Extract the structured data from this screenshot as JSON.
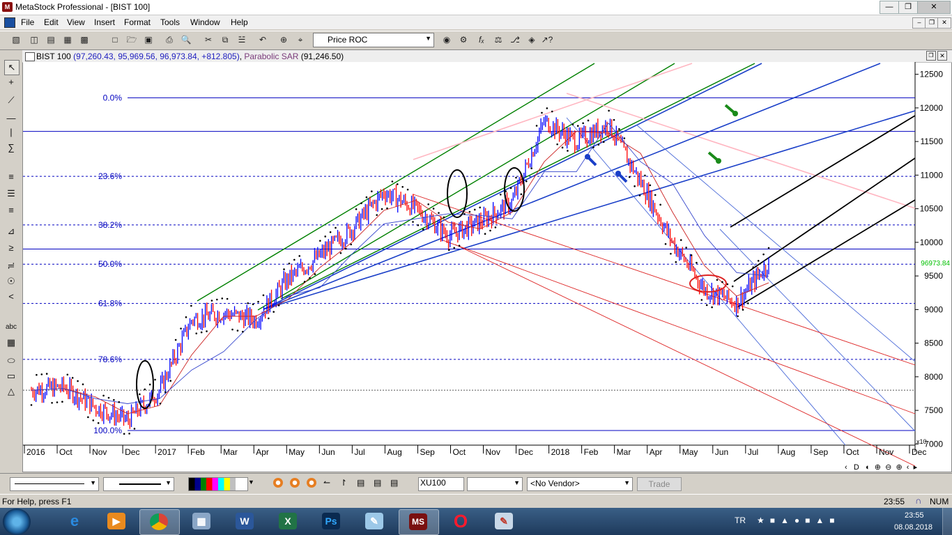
{
  "window": {
    "title": "MetaStock Professional - [BIST 100]"
  },
  "menu": [
    "File",
    "Edit",
    "View",
    "Insert",
    "Format",
    "Tools",
    "Window",
    "Help"
  ],
  "toolbar": {
    "indicator_select": "Price ROC"
  },
  "chart": {
    "symbol": "BIST 100",
    "ohlc": "(97,260.43, 95,969.56, 96,973.84, +812.805)",
    "indicator": "Parabolic SAR",
    "indicator_value": "(91,246.50)",
    "last_price": "96973.84",
    "y_ticks": [
      "12500",
      "12000",
      "11500",
      "11000",
      "10500",
      "10000",
      "9500",
      "9000",
      "8500",
      "8000",
      "7500",
      "7000"
    ],
    "y_scale_label": "x10",
    "x_labels": [
      "2016",
      "Oct",
      "Nov",
      "Dec",
      "2017",
      "Feb",
      "Mar",
      "Apr",
      "May",
      "Jun",
      "Jul",
      "Aug",
      "Sep",
      "Oct",
      "Nov",
      "Dec",
      "2018",
      "Feb",
      "Mar",
      "Apr",
      "May",
      "Jun",
      "Jul",
      "Aug",
      "Sep",
      "Oct",
      "Nov",
      "Dec"
    ],
    "fib_levels": [
      "0.0%",
      "23.6%",
      "38.2%",
      "50.0%",
      "61.8%",
      "78.6%",
      "100.0%"
    ],
    "colors": {
      "up": "#0000ff",
      "down": "#ff0000",
      "green_channel": "#008000",
      "pink_channel": "#ffb6c1",
      "fib_line": "#0000c0",
      "price_label": "#00c000"
    }
  },
  "chart_data": {
    "type": "line",
    "title": "BIST 100",
    "ylabel": "",
    "xlabel": "",
    "ylim": [
      6900,
      12600
    ],
    "scale_factor": "x10",
    "series": [
      {
        "name": "BIST 100",
        "x": [
          "2016-09",
          "2016-10",
          "2016-11",
          "2016-12",
          "2017-01",
          "2017-02",
          "2017-03",
          "2017-04",
          "2017-05",
          "2017-06",
          "2017-07",
          "2017-08",
          "2017-09",
          "2017-10",
          "2017-11",
          "2017-12",
          "2018-01",
          "2018-02",
          "2018-03",
          "2018-04",
          "2018-05",
          "2018-06",
          "2018-07",
          "2018-08"
        ],
        "values": [
          7800,
          7850,
          7550,
          7350,
          7800,
          8850,
          8950,
          8850,
          9450,
          9800,
          10200,
          10750,
          10500,
          10100,
          10300,
          10600,
          11800,
          11500,
          11750,
          10900,
          10000,
          9300,
          9100,
          9697
        ]
      }
    ]
  },
  "bottom": {
    "symbol_box": "XU100",
    "vendor": "<No Vendor>",
    "trade_button": "Trade"
  },
  "status": {
    "help": "For Help, press F1",
    "time": "23:55",
    "num": "NUM"
  },
  "taskbar": {
    "language": "TR",
    "time": "23:55",
    "date": "08.08.2018"
  }
}
